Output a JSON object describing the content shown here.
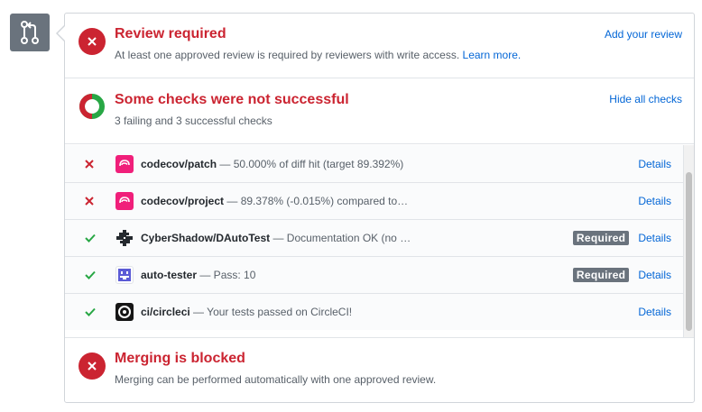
{
  "review": {
    "title": "Review required",
    "description": "At least one approved review is required by reviewers with write access.",
    "learn_more": "Learn more.",
    "action": "Add your review"
  },
  "checks": {
    "title": "Some checks were not successful",
    "summary": "3 failing and 3 successful checks",
    "action": "Hide all checks",
    "items": [
      {
        "name": "codecov/patch",
        "description": " — 50.000% of diff hit (target 89.392%)",
        "status": "failure",
        "required": "",
        "details": "Details",
        "icon": "codecov-icon"
      },
      {
        "name": "codecov/project",
        "description": " — 89.378% (-0.015%) compared to…",
        "status": "failure",
        "required": "",
        "details": "Details",
        "icon": "codecov-icon"
      },
      {
        "name": "CyberShadow/DAutoTest",
        "description": " — Documentation OK (no …",
        "status": "success",
        "required": "Required",
        "details": "Details",
        "icon": "dautotest-icon"
      },
      {
        "name": "auto-tester",
        "description": " — Pass: 10",
        "status": "success",
        "required": "Required",
        "details": "Details",
        "icon": "auto-tester-icon"
      },
      {
        "name": "ci/circleci",
        "description": " — Your tests passed on CircleCI!",
        "status": "success",
        "required": "",
        "details": "Details",
        "icon": "circleci-icon"
      }
    ]
  },
  "merge": {
    "title": "Merging is blocked",
    "description": "Merging can be performed automatically with one approved review."
  },
  "colors": {
    "failure": "#cb2431",
    "success": "#28a745",
    "link": "#0366d6",
    "codecov": "#f01f7a"
  }
}
